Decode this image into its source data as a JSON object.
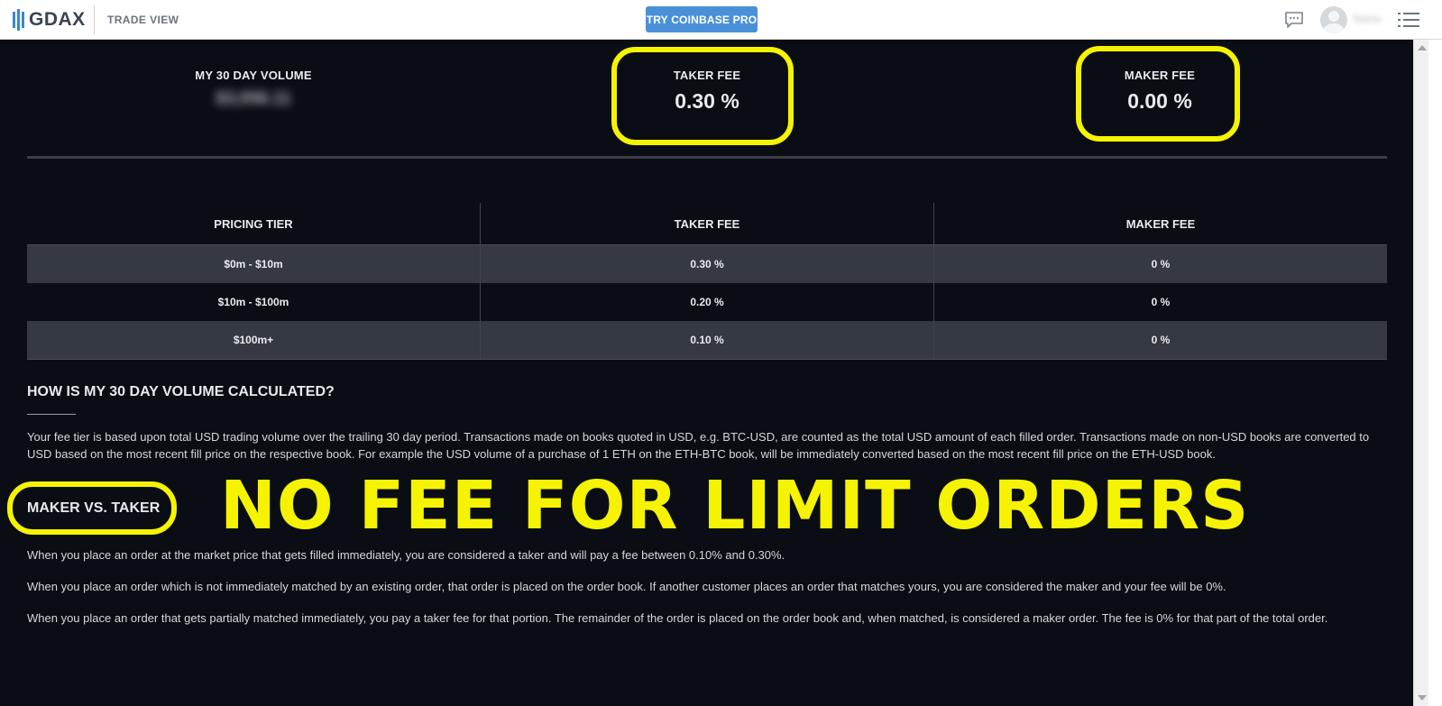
{
  "header": {
    "logo_text": "GDAX",
    "trade_view_label": "TRADE VIEW",
    "try_button_label": "TRY COINBASE PRO",
    "username": "Name",
    "accent_color": "#4a90d9"
  },
  "stats": {
    "volume_label": "MY 30 DAY VOLUME",
    "volume_value": "$3,056.11",
    "taker_label": "TAKER FEE",
    "taker_value": "0.30 %",
    "maker_label": "MAKER FEE",
    "maker_value": "0.00 %"
  },
  "table": {
    "headers": [
      "PRICING TIER",
      "TAKER FEE",
      "MAKER FEE"
    ],
    "rows": [
      [
        "$0m - $10m",
        "0.30 %",
        "0 %"
      ],
      [
        "$10m - $100m",
        "0.20 %",
        "0 %"
      ],
      [
        "$100m+",
        "0.10 %",
        "0 %"
      ]
    ]
  },
  "volume_section": {
    "title": "HOW IS MY 30 DAY VOLUME CALCULATED?",
    "body": "Your fee tier is based upon total USD trading volume over the trailing 30 day period. Transactions made on books quoted in USD, e.g. BTC-USD, are counted as the total USD amount of each filled order. Transactions made on non-USD books are converted to USD based on the most recent fill price on the respective book. For example the USD volume of a purchase of 1 ETH on the ETH-BTC book, will be immediately converted based on the most recent fill price on the ETH-USD book."
  },
  "maker_taker_section": {
    "title": "MAKER VS. TAKER",
    "para1": "When you place an order at the market price that gets filled immediately, you are considered a taker and will pay a fee between 0.10% and 0.30%.",
    "para2": "When you place an order which is not immediately matched by an existing order, that order is placed on the order book. If another customer places an order that matches yours, you are considered the maker and your fee will be 0%.",
    "para3": "When you place an order that gets partially matched immediately, you pay a taker fee for that portion. The remainder of the order is placed on the order book and, when matched, is considered a maker order. The fee is 0% for that part of the total order."
  },
  "annotation": {
    "text": "NO FEE FOR LIMIT ORDERS",
    "color": "#f6f300"
  }
}
